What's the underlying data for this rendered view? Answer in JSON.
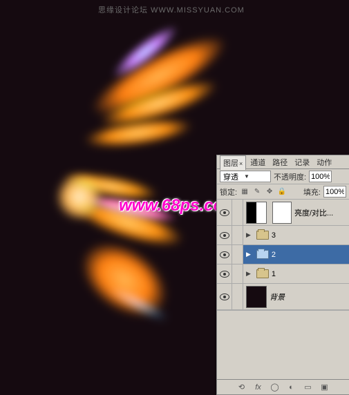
{
  "watermark_top": "思缘设计论坛 WWW.MISSYUAN.COM",
  "watermark_center": "www.68ps.com",
  "panel": {
    "tabs": {
      "layers": "图层",
      "channels": "通道",
      "paths": "路径",
      "history": "记录",
      "actions": "动作"
    },
    "blend_mode": "穿透",
    "opacity_label": "不透明度:",
    "opacity_value": "100%",
    "lock_label": "锁定:",
    "fill_label": "填充:",
    "fill_value": "100%",
    "layers": {
      "adj": {
        "name": "亮度/对比..."
      },
      "group3": {
        "name": "3"
      },
      "group2": {
        "name": "2"
      },
      "group1": {
        "name": "1"
      },
      "bg": {
        "name": "背景"
      }
    }
  }
}
